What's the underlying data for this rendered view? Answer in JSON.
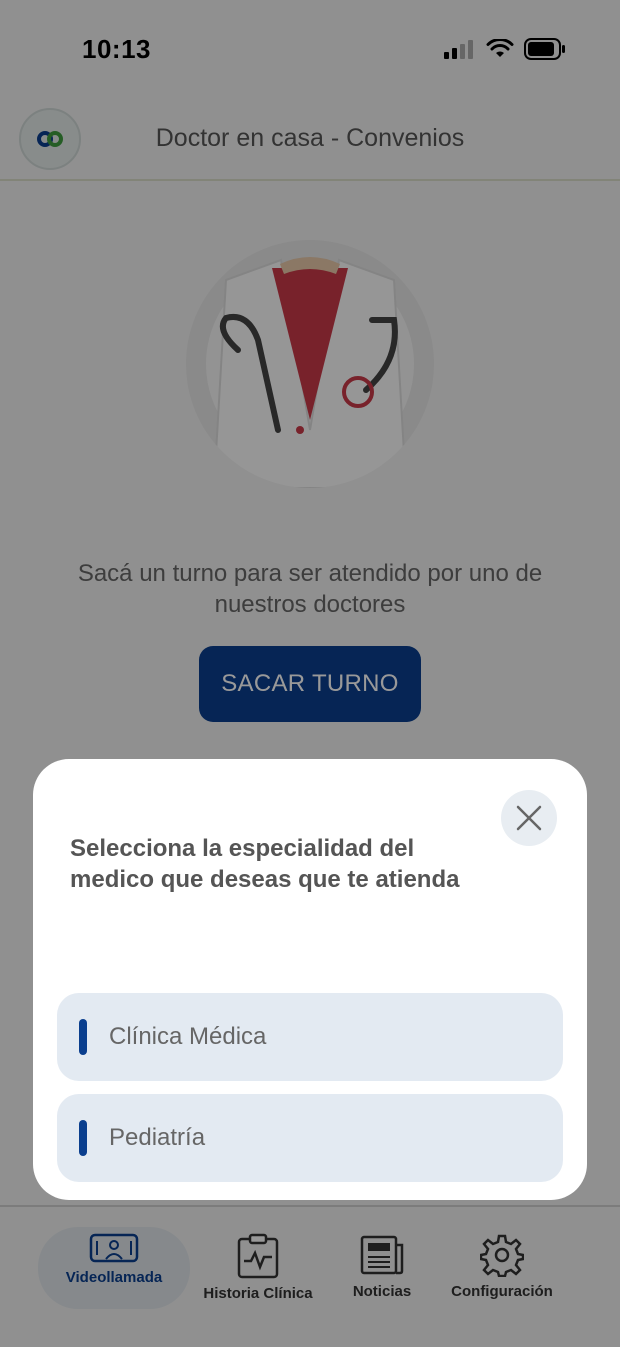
{
  "status": {
    "time": "10:13",
    "icons": [
      "cellular-signal-icon",
      "wifi-icon",
      "battery-icon"
    ]
  },
  "header": {
    "title": "Doctor en casa - Convenios",
    "avatar_icon": "link-logo-icon"
  },
  "main": {
    "hero_image": "doctor-illustration",
    "prompt_text": "Sacá un turno para ser atendido por uno de nuestros doctores",
    "cta_label": "SACAR TURNO"
  },
  "modal": {
    "title": "Selecciona la especialidad del medico que deseas que te atienda",
    "options": [
      {
        "label": "Clínica Médica"
      },
      {
        "label": "Pediatría"
      }
    ],
    "close_icon": "close-icon"
  },
  "tabs": [
    {
      "label": "Videollamada",
      "icon": "video-call-icon",
      "active": true
    },
    {
      "label": "Historia Clínica",
      "icon": "clipboard-icon",
      "active": false
    },
    {
      "label": "Noticias",
      "icon": "newspaper-icon",
      "active": false
    },
    {
      "label": "Configuración",
      "icon": "gear-icon",
      "active": false
    }
  ],
  "colors": {
    "accent": "#0b3f8e",
    "overlay": "rgba(0,0,0,0.40)",
    "option_bg": "#e3eaf2"
  }
}
